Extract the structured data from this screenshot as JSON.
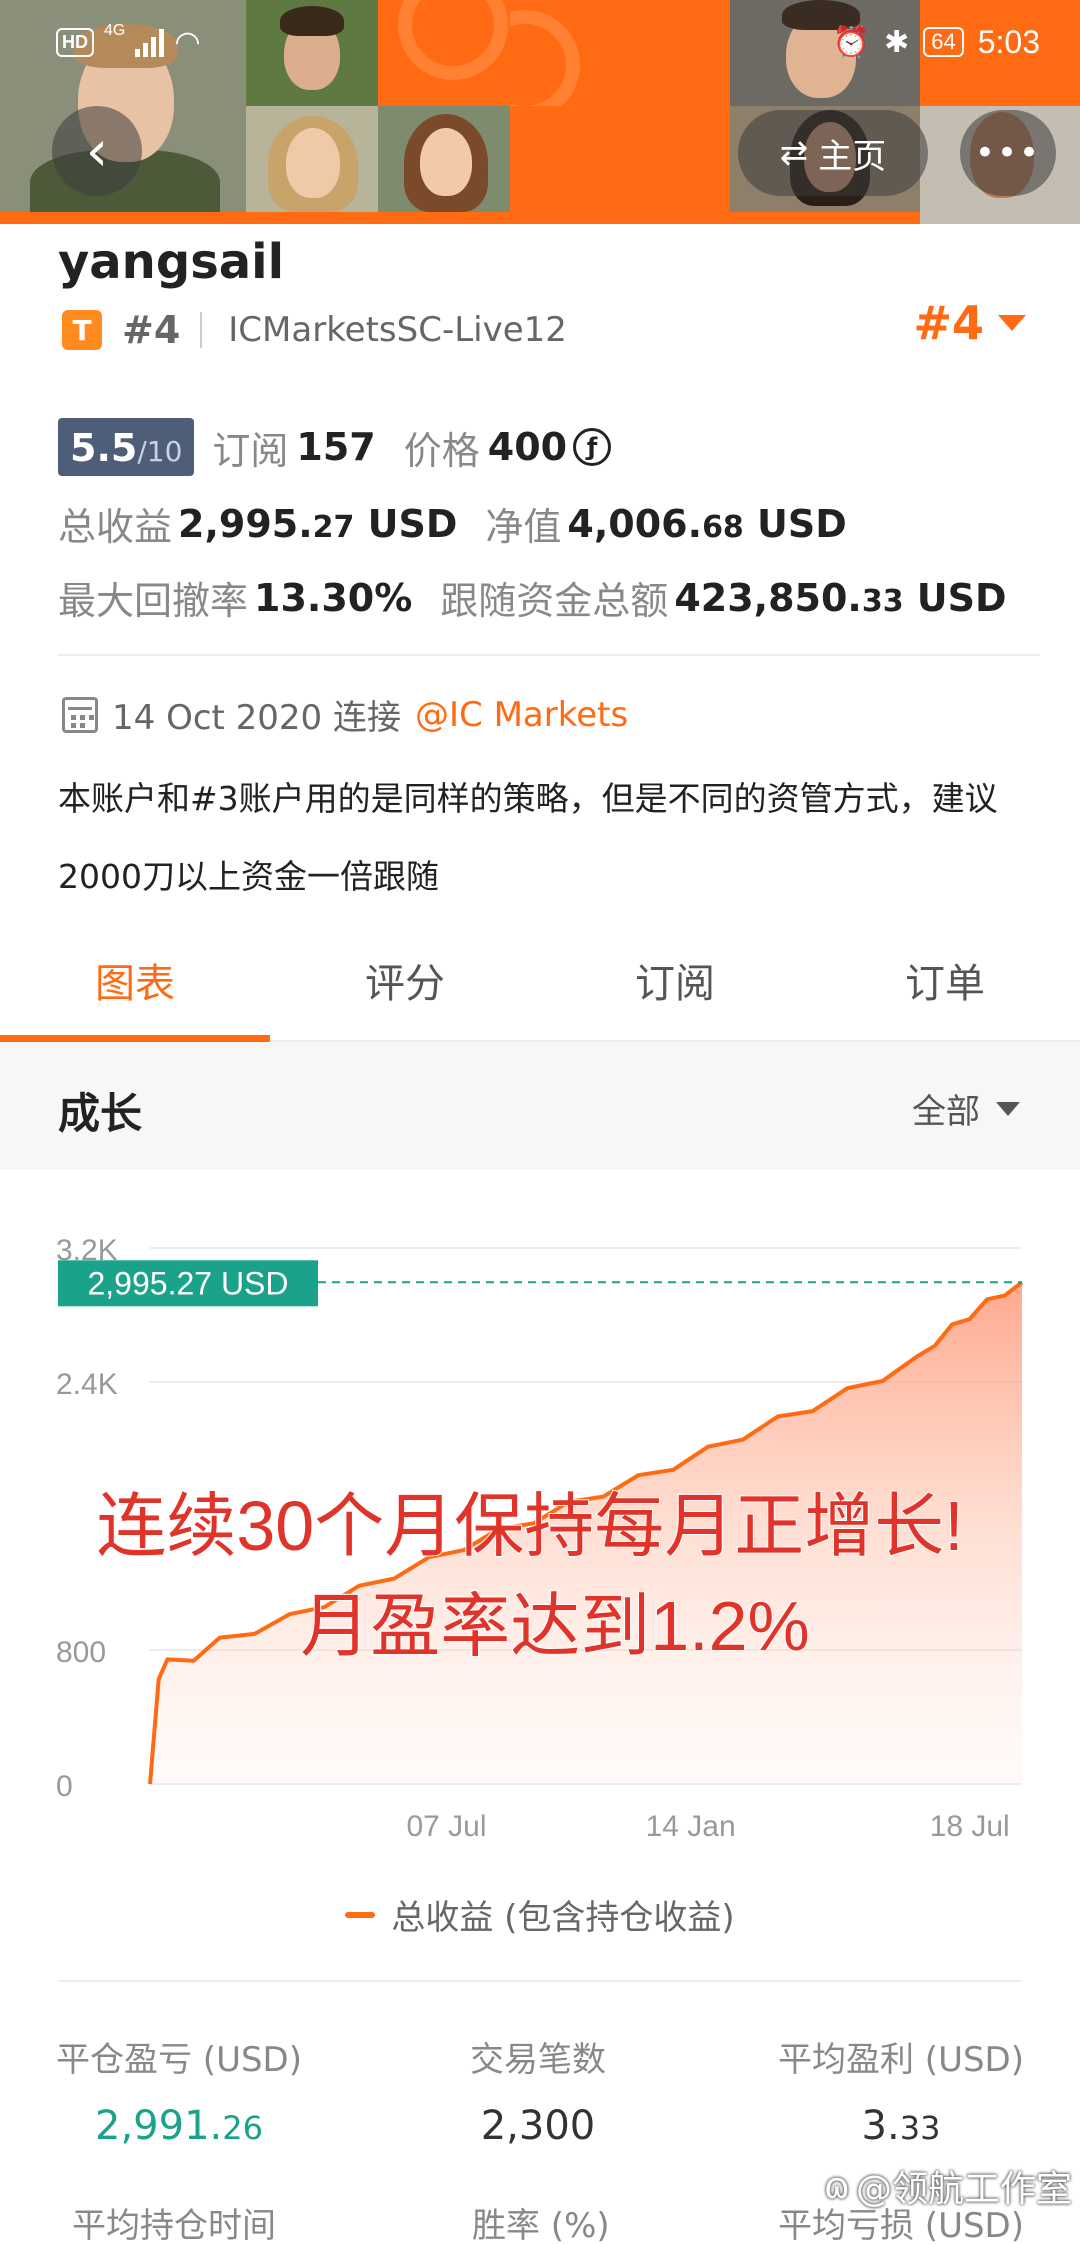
{
  "status_bar": {
    "hd": "HD",
    "network": "4G",
    "time": "5:03",
    "battery": "64"
  },
  "header": {
    "back_icon": "chevron-left-icon",
    "home_label": "主页",
    "home_icon": "swap-arrows-icon",
    "more_label": "•••"
  },
  "profile": {
    "username": "yangsail",
    "badge": "T",
    "rank": "#4",
    "account": "ICMarketsSC-Live12",
    "rank_right": "#4",
    "score_main": "5.5",
    "score_den": "/10",
    "subscribe_label": "订阅",
    "subscribe_count": "157",
    "price_label": "价格",
    "price_value": "400",
    "price_icon": "ƒ",
    "total_profit_label": "总收益",
    "total_profit_main": "2,995.",
    "total_profit_dec": "27",
    "total_profit_unit": " USD",
    "equity_label": "净值",
    "equity_main": "4,006.",
    "equity_dec": "68",
    "equity_unit": " USD",
    "drawdown_label": "最大回撤率",
    "drawdown_value": "13.30%",
    "follow_label": "跟随资金总额",
    "follow_main": "423,850.",
    "follow_dec": "33",
    "follow_unit": " USD",
    "connect_date": "14 Oct 2020 连接",
    "broker": "@IC Markets",
    "description": "本账户和#3账户用的是同样的策略，但是不同的资管方式，建议2000刀以上资金一倍跟随"
  },
  "tabs": [
    {
      "label": "图表",
      "active": true
    },
    {
      "label": "评分",
      "active": false
    },
    {
      "label": "订阅",
      "active": false
    },
    {
      "label": "订单",
      "active": false
    }
  ],
  "growth": {
    "title": "成长",
    "range": "全部"
  },
  "chart_data": {
    "type": "area",
    "ylim": [
      0,
      3200
    ],
    "y_ticks": [
      "3.2K",
      "2.4K",
      "800",
      "0"
    ],
    "y_tick_values": [
      3200,
      2400,
      800,
      0
    ],
    "x_ticks": [
      "07 Jul",
      "14 Jan",
      "18 Jul"
    ],
    "current_label": "2,995.27 USD",
    "current_value": 2995.27,
    "overlay_line1": "连续30个月保持每月正增长!",
    "overlay_line2": "月盈率达到1.2%",
    "series": [
      {
        "name": "总收益 (包含持仓收益)",
        "color": "#ff6a13",
        "x": [
          0,
          0.01,
          0.02,
          0.05,
          0.08,
          0.12,
          0.16,
          0.2,
          0.24,
          0.28,
          0.32,
          0.36,
          0.4,
          0.44,
          0.48,
          0.52,
          0.56,
          0.6,
          0.64,
          0.68,
          0.72,
          0.76,
          0.8,
          0.84,
          0.88,
          0.9,
          0.92,
          0.94,
          0.96,
          0.98,
          1.0
        ],
        "values": [
          0,
          650,
          720,
          760,
          850,
          920,
          990,
          1080,
          1160,
          1250,
          1330,
          1420,
          1500,
          1580,
          1660,
          1740,
          1820,
          1900,
          1990,
          2080,
          2170,
          2250,
          2340,
          2430,
          2530,
          2640,
          2720,
          2800,
          2870,
          2940,
          2995.27
        ]
      }
    ]
  },
  "legend": {
    "label": "总收益 (包含持仓收益)"
  },
  "summary": {
    "closed_pl_label": "平仓盈亏 (USD)",
    "closed_pl_main": "2,991.",
    "closed_pl_dec": "26",
    "trades_label": "交易笔数",
    "trades_value": "2,300",
    "avg_profit_label": "平均盈利 (USD)",
    "avg_profit_main": "3.",
    "avg_profit_dec": "33",
    "avg_hold_label": "平均持仓时间",
    "winrate_label": "胜率 (%)",
    "avg_loss_label": "平均亏损 (USD)"
  },
  "watermark": "@领航工作室"
}
